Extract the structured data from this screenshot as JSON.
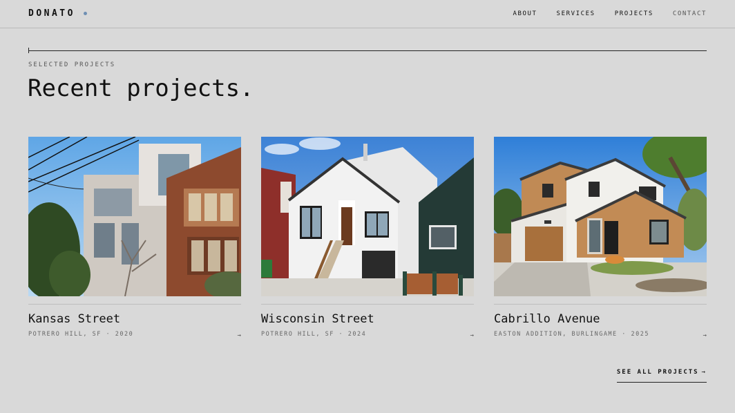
{
  "brand": {
    "name": "DONATO",
    "dot_color": "#6f8fb3"
  },
  "nav": {
    "items": [
      {
        "label": "ABOUT"
      },
      {
        "label": "SERVICES"
      },
      {
        "label": "PROJECTS"
      },
      {
        "label": "CONTACT"
      }
    ]
  },
  "section": {
    "eyebrow": "SELECTED PROJECTS",
    "headline": "Recent projects."
  },
  "projects": [
    {
      "title": "Kansas Street",
      "meta": "POTRERO HILL, SF · 2020",
      "arrow": "→",
      "image_icon": "house-photo-icon"
    },
    {
      "title": "Wisconsin Street",
      "meta": "POTRERO HILL, SF · 2024",
      "arrow": "→",
      "image_icon": "house-photo-icon"
    },
    {
      "title": "Cabrillo Avenue",
      "meta": "EASTON ADDITION, BURLINGAME · 2025",
      "arrow": "→",
      "image_icon": "house-photo-icon"
    }
  ],
  "cta": {
    "label": "SEE ALL PROJECTS",
    "arrow": "→"
  },
  "colors": {
    "background": "#d9d9d9",
    "text": "#111111",
    "muted": "#666666"
  }
}
